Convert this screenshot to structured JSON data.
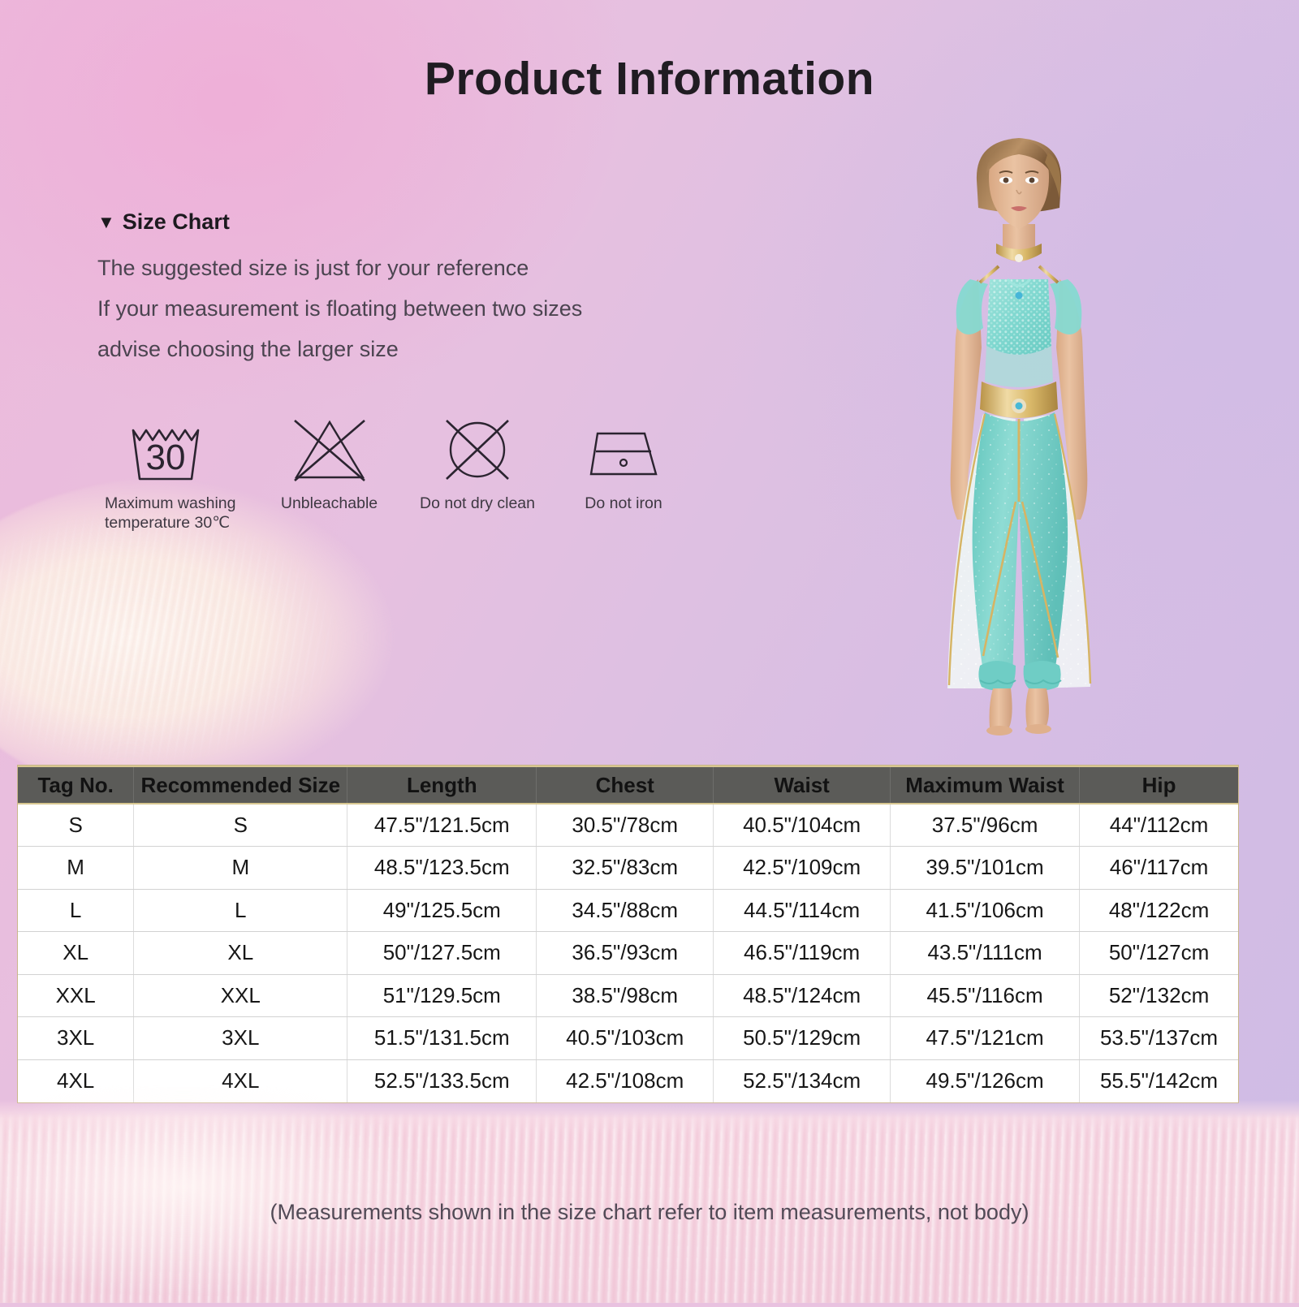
{
  "page": {
    "title": "Product  Information",
    "footnote": "(Measurements shown in the size chart refer to item measurements, not body)",
    "background": {
      "top_left_color": "#ecb9dc",
      "top_right_color": "#d2bce4",
      "fur_left_color": "#fbeee8",
      "fur_bottom_color": "#f7dbe5"
    }
  },
  "size_chart": {
    "heading": "Size Chart",
    "heading_marker": "▼",
    "notes": [
      "The suggested size is just for your reference",
      "If your measurement is floating between two sizes",
      "advise choosing the larger size"
    ]
  },
  "care_symbols": [
    {
      "icon": "wash-tub-30-icon",
      "label": "Maximum washing\ntemperature 30℃",
      "temperature": "30"
    },
    {
      "icon": "no-bleach-icon",
      "label": "Unbleachable"
    },
    {
      "icon": "no-dry-clean-icon",
      "label": "Do not dry clean"
    },
    {
      "icon": "no-iron-icon",
      "label": "Do not iron"
    }
  ],
  "model_photo": {
    "alt": "woman wearing turquoise princess costume with gold belt and choker",
    "costume_color": "#7ed7cf",
    "accent_color": "#d8b667",
    "skin_color": "#e4b999"
  },
  "chart_data": {
    "type": "table",
    "title": "Size Chart",
    "columns": [
      "Tag No.",
      "Recommended Size",
      "Length",
      "Chest",
      "Waist",
      "Maximum Waist",
      "Hip"
    ],
    "rows": [
      [
        "S",
        "S",
        "47.5\"/121.5cm",
        "30.5\"/78cm",
        "40.5\"/104cm",
        "37.5\"/96cm",
        "44\"/112cm"
      ],
      [
        "M",
        "M",
        "48.5\"/123.5cm",
        "32.5\"/83cm",
        "42.5\"/109cm",
        "39.5\"/101cm",
        "46\"/117cm"
      ],
      [
        "L",
        "L",
        "49\"/125.5cm",
        "34.5\"/88cm",
        "44.5\"/114cm",
        "41.5\"/106cm",
        "48\"/122cm"
      ],
      [
        "XL",
        "XL",
        "50\"/127.5cm",
        "36.5\"/93cm",
        "46.5\"/119cm",
        "43.5\"/111cm",
        "50\"/127cm"
      ],
      [
        "XXL",
        "XXL",
        "51\"/129.5cm",
        "38.5\"/98cm",
        "48.5\"/124cm",
        "45.5\"/116cm",
        "52\"/132cm"
      ],
      [
        "3XL",
        "3XL",
        "51.5\"/131.5cm",
        "40.5\"/103cm",
        "50.5\"/129cm",
        "47.5\"/121cm",
        "53.5\"/137cm"
      ],
      [
        "4XL",
        "4XL",
        "52.5\"/133.5cm",
        "42.5\"/108cm",
        "52.5\"/134cm",
        "49.5\"/126cm",
        "55.5\"/142cm"
      ]
    ],
    "header_bg": "#5b5b58",
    "row_bg": "#ffffff"
  }
}
